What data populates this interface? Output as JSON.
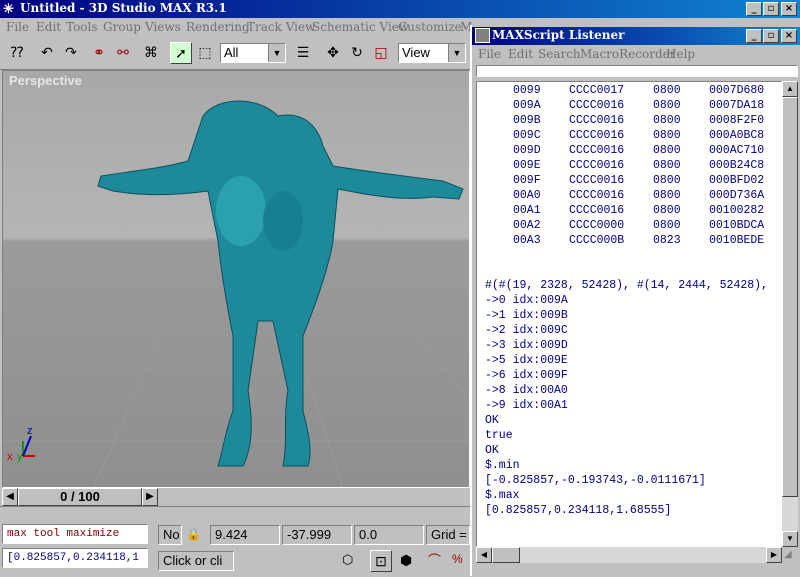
{
  "app": {
    "title": "Untitled - 3D Studio MAX R3.1",
    "menu": [
      "File",
      "Edit",
      "Tools",
      "Group",
      "Views",
      "Rendering",
      "Track View",
      "Schematic View",
      "Customize",
      "M"
    ],
    "window_buttons": [
      "_",
      "▫",
      "×"
    ]
  },
  "toolbar": {
    "selection_filter": "All",
    "coordinate_system": "View"
  },
  "viewport": {
    "label": "Perspective",
    "axis_x": "x",
    "axis_y": "y",
    "axis_z": "z"
  },
  "timeline": {
    "frame": "0 / 100"
  },
  "status": {
    "maxscript_mini": "max tool maximize",
    "maxscript_output": "[0.825857,0.234118,1",
    "no_label": "No",
    "x_value": "9.424",
    "y_value": "-37.999",
    "z_value": "0.0",
    "grid_label": "Grid =",
    "prompt": "Click or cli"
  },
  "listener": {
    "title": "MAXScript Listener",
    "menu": [
      "File",
      "Edit",
      "Search",
      "MacroRecorder",
      "Help"
    ],
    "table": [
      [
        "0099",
        "CCCC0017",
        "0800",
        "0007D680"
      ],
      [
        "009A",
        "CCCC0016",
        "0800",
        "0007DA18"
      ],
      [
        "009B",
        "CCCC0016",
        "0800",
        "0008F2F0"
      ],
      [
        "009C",
        "CCCC0016",
        "0800",
        "000A0BC8"
      ],
      [
        "009D",
        "CCCC0016",
        "0800",
        "000AC710"
      ],
      [
        "009E",
        "CCCC0016",
        "0800",
        "000B24C8"
      ],
      [
        "009F",
        "CCCC0016",
        "0800",
        "000BFD02"
      ],
      [
        "00A0",
        "CCCC0016",
        "0800",
        "000D736A"
      ],
      [
        "00A1",
        "CCCC0016",
        "0800",
        "00100282"
      ],
      [
        "00A2",
        "CCCC0000",
        "0800",
        "0010BDCA"
      ],
      [
        "00A3",
        "CCCC000B",
        "0823",
        "0010BEDE"
      ]
    ],
    "lines": [
      "#(#(19, 2328, 52428), #(14, 2444, 52428),",
      "->0 idx:009A",
      "->1 idx:009B",
      "->2 idx:009C",
      "->3 idx:009D",
      "->5 idx:009E",
      "->6 idx:009F",
      "->8 idx:00A0",
      "->9 idx:00A1",
      "OK",
      "true",
      "OK",
      "$.min",
      "[-0.825857,-0.193743,-0.0111671]",
      "$.max",
      "[0.825857,0.234118,1.68555]"
    ]
  }
}
